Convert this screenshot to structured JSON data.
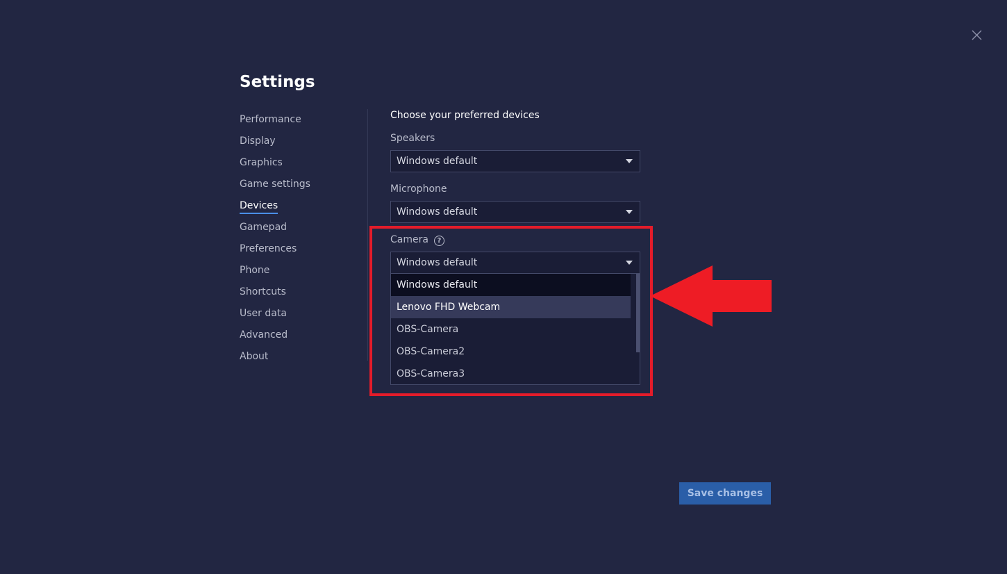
{
  "title": "Settings",
  "nav": {
    "items": [
      {
        "label": "Performance"
      },
      {
        "label": "Display"
      },
      {
        "label": "Graphics"
      },
      {
        "label": "Game settings"
      },
      {
        "label": "Devices",
        "active": true
      },
      {
        "label": "Gamepad"
      },
      {
        "label": "Preferences"
      },
      {
        "label": "Phone"
      },
      {
        "label": "Shortcuts"
      },
      {
        "label": "User data"
      },
      {
        "label": "Advanced"
      },
      {
        "label": "About"
      }
    ]
  },
  "devices": {
    "section_title": "Choose your preferred devices",
    "speakers": {
      "label": "Speakers",
      "value": "Windows default"
    },
    "microphone": {
      "label": "Microphone",
      "value": "Windows default"
    },
    "camera": {
      "label": "Camera",
      "help_icon": "?",
      "value": "Windows default",
      "options": [
        {
          "label": "Windows default",
          "state": "selected"
        },
        {
          "label": "Lenovo FHD Webcam",
          "state": "hovered"
        },
        {
          "label": "OBS-Camera",
          "state": "normal"
        },
        {
          "label": "OBS-Camera2",
          "state": "normal"
        },
        {
          "label": "OBS-Camera3",
          "state": "normal"
        }
      ]
    }
  },
  "save_button": {
    "label": "Save changes"
  },
  "icons": {
    "close": "close-icon",
    "caret": "caret-down-icon",
    "help": "help-circle-icon",
    "annotation_arrow": "arrow-left-icon"
  },
  "colors": {
    "background": "#222642",
    "accent": "#4a8fe8",
    "highlight": "#e31c2a",
    "save_button": "#2a5ea8"
  }
}
